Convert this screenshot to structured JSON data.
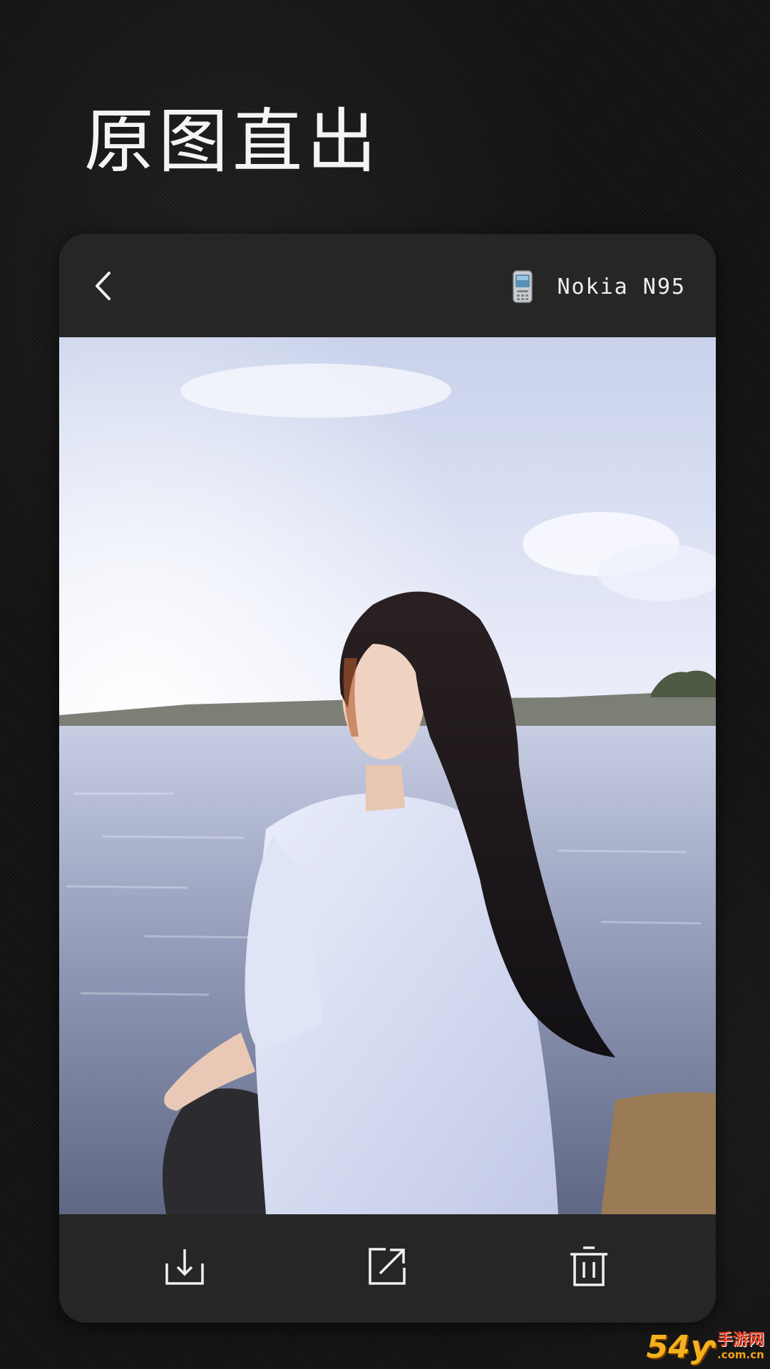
{
  "page": {
    "headline": "原图直出"
  },
  "viewer": {
    "back_icon": "chevron-left-icon",
    "device_icon": "mobile-phone-icon",
    "device_name": "Nokia N95",
    "photo_subject": "photo-of-woman-by-water"
  },
  "toolbar": {
    "download_icon": "download-icon",
    "share_icon": "share-export-icon",
    "delete_icon": "trash-icon"
  },
  "watermark": {
    "main": "54ƴ",
    "cn": "手游网",
    "domain": ".com.cn"
  },
  "colors": {
    "background": "#141414",
    "card": "#262626",
    "text": "#f0f0f0",
    "watermark_gold": "#f3b21c",
    "watermark_red": "#e53b1f"
  }
}
